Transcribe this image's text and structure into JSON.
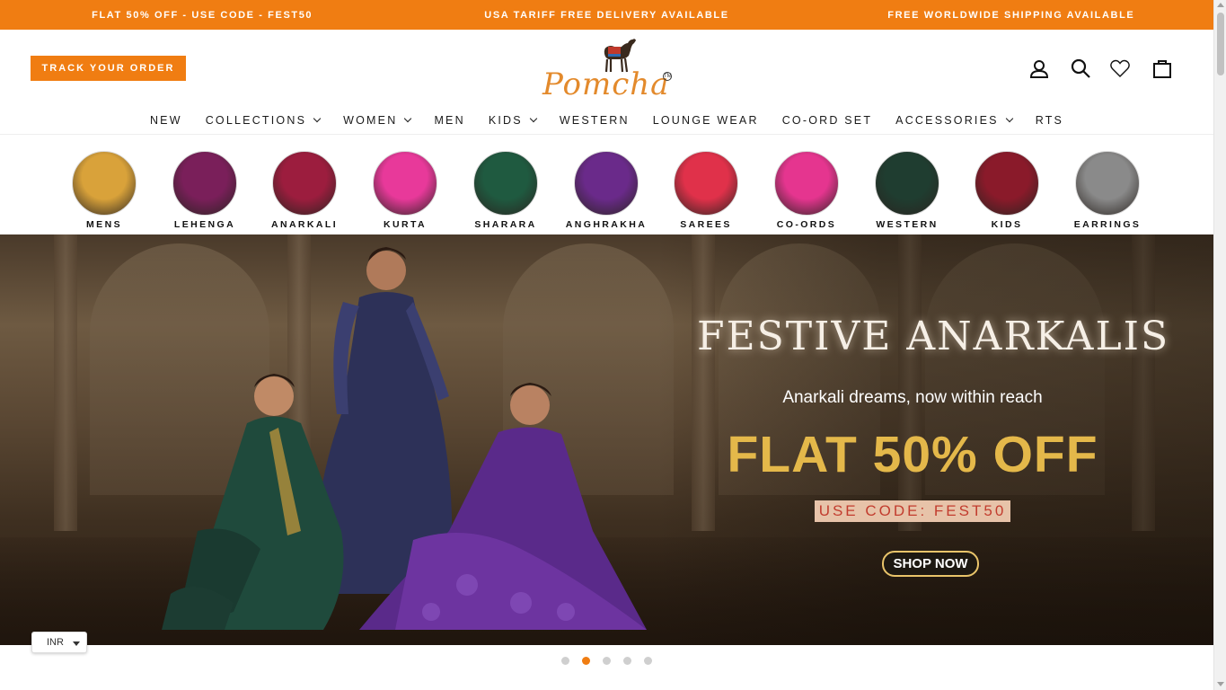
{
  "announcement": [
    "FLAT 50% OFF - USE CODE - FEST50",
    "USA TARIFF FREE DELIVERY AVAILABLE",
    "FREE WORLDWIDE SHIPPING AVAILABLE"
  ],
  "header": {
    "track_order": "TRACK YOUR ORDER",
    "logo_text": "Pomcha",
    "logo_tm": "TM",
    "icons": [
      "account-icon",
      "search-icon",
      "wishlist-heart-icon",
      "cart-bag-icon"
    ]
  },
  "nav": [
    {
      "label": "NEW",
      "dropdown": false
    },
    {
      "label": "COLLECTIONS",
      "dropdown": true
    },
    {
      "label": "WOMEN",
      "dropdown": true
    },
    {
      "label": "MEN",
      "dropdown": false
    },
    {
      "label": "KIDS",
      "dropdown": true
    },
    {
      "label": "WESTERN",
      "dropdown": false
    },
    {
      "label": "LOUNGE WEAR",
      "dropdown": false
    },
    {
      "label": "CO-ORD SET",
      "dropdown": false
    },
    {
      "label": "ACCESSORIES",
      "dropdown": true
    },
    {
      "label": "RTS",
      "dropdown": false
    }
  ],
  "categories": [
    {
      "label": "MENS",
      "color": "#d9a23a"
    },
    {
      "label": "LEHENGA",
      "color": "#7a1f5a"
    },
    {
      "label": "ANARKALI",
      "color": "#9c1d3e"
    },
    {
      "label": "KURTA",
      "color": "#e8399a"
    },
    {
      "label": "SHARARA",
      "color": "#1f5a40"
    },
    {
      "label": "ANGHRAKHA",
      "color": "#6a2a8a"
    },
    {
      "label": "SAREES",
      "color": "#e0314a"
    },
    {
      "label": "CO-ORDS",
      "color": "#e5358f"
    },
    {
      "label": "WESTERN",
      "color": "#1f3d30"
    },
    {
      "label": "KIDS",
      "color": "#8a1a2a"
    },
    {
      "label": "EARRINGS",
      "color": "#8a8a8a"
    }
  ],
  "hero": {
    "title": "FESTIVE ANARKALIS",
    "subtitle": "Anarkali dreams, now within reach",
    "offer": "FLAT 50% OFF",
    "code": "USE CODE: FEST50",
    "cta": "SHOP NOW"
  },
  "currency": "INR",
  "slider": {
    "count": 5,
    "active": 2
  },
  "colors": {
    "accent": "#f07d12",
    "gold": "#e4b84a"
  }
}
